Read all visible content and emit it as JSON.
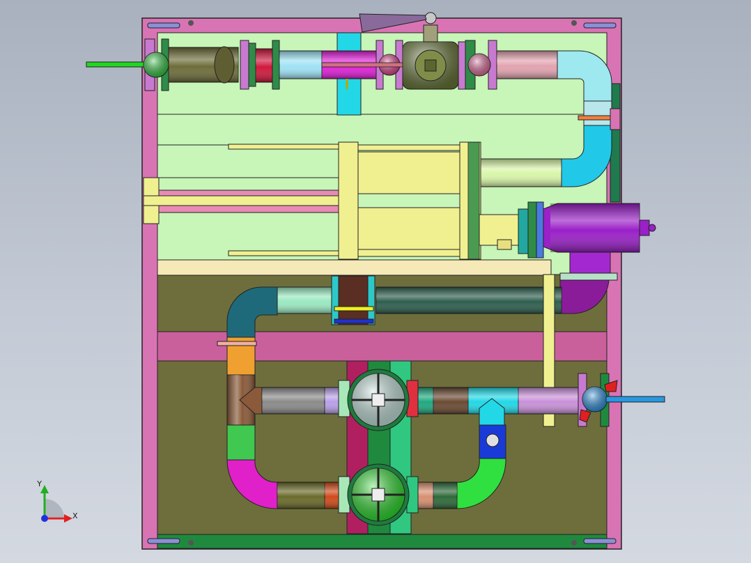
{
  "viewport": {
    "background_top": "#a9b1bf",
    "background_bottom": "#d4d9e1"
  },
  "triad": {
    "x_label": "X",
    "y_label": "Y",
    "x_color": "#e02020",
    "y_color": "#20b020",
    "z_color": "#2030e0"
  },
  "model": {
    "frame_color": "#d874b4",
    "upper_panel_color": "#c8f5b8",
    "lower_panel_color": "#6e6e3c",
    "components": [
      "frame",
      "upper-pipeline",
      "ball-valve",
      "pneumatic-cylinder",
      "purple-reducer-tee",
      "middle-return-pipe",
      "lower-manifold",
      "strainer-upper",
      "strainer-lower",
      "inlet-lever-valve",
      "outlet-lever-valve"
    ]
  }
}
